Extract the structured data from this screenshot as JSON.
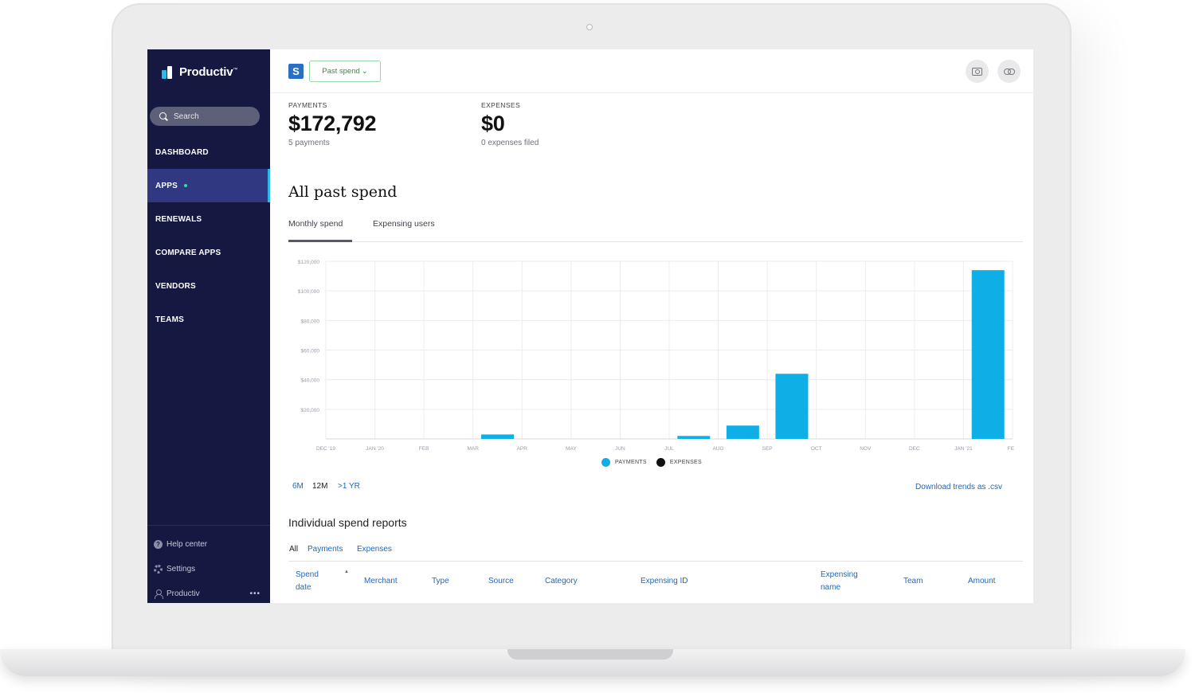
{
  "sidebar": {
    "brand": "Productiv",
    "search_label": "Search",
    "nav": [
      {
        "label": "DASHBOARD",
        "active": false
      },
      {
        "label": "APPS",
        "active": true
      },
      {
        "label": "RENEWALS",
        "active": false
      },
      {
        "label": "COMPARE APPS",
        "active": false
      },
      {
        "label": "VENDORS",
        "active": false
      },
      {
        "label": "TEAMS",
        "active": false
      }
    ],
    "footer": {
      "help": "Help center",
      "settings": "Settings",
      "account": "Productiv",
      "more": "•••"
    }
  },
  "header": {
    "app_icon_letter": "S",
    "period_selector": "Past spend",
    "actions": [
      "camera-icon",
      "link-icon"
    ]
  },
  "stats": {
    "payments": {
      "label": "PAYMENTS",
      "value": "$172,792",
      "sub": "5 payments"
    },
    "expenses": {
      "label": "EXPENSES",
      "value": "$0",
      "sub": "0 expenses filed"
    }
  },
  "section": {
    "title": "All past spend",
    "tabs": [
      {
        "label": "Monthly spend",
        "active": true
      },
      {
        "label": "Expensing users",
        "active": false
      }
    ]
  },
  "chart_data": {
    "type": "bar",
    "categories": [
      "DEC '19",
      "JAN '20",
      "FEB",
      "MAR",
      "APR",
      "MAY",
      "JUN",
      "JUL",
      "AUG",
      "SEP",
      "OCT",
      "NOV",
      "DEC",
      "JAN '21",
      "FEB"
    ],
    "series": [
      {
        "name": "PAYMENTS",
        "color": "#0eaee6",
        "values": [
          0,
          0,
          0,
          3000,
          0,
          0,
          0,
          2000,
          9000,
          44000,
          0,
          0,
          0,
          114000,
          0
        ]
      },
      {
        "name": "EXPENSES",
        "color": "#111111",
        "values": [
          0,
          0,
          0,
          0,
          0,
          0,
          0,
          0,
          0,
          0,
          0,
          0,
          0,
          0,
          0
        ]
      }
    ],
    "yticks": [
      "$120,000",
      "$100,000",
      "$80,000",
      "$60,000",
      "$40,000",
      "$20,000"
    ],
    "ylim": [
      0,
      120000
    ],
    "grid": true,
    "legend": "bottom-center"
  },
  "range_options": [
    {
      "label": "6M",
      "selected": false
    },
    {
      "label": "12M",
      "selected": true
    },
    {
      "label": ">1 YR",
      "selected": false
    }
  ],
  "download_label": "Download trends as .csv",
  "reports": {
    "title": "Individual spend reports",
    "filters": [
      {
        "label": "All",
        "selected": true
      },
      {
        "label": "Payments",
        "selected": false
      },
      {
        "label": "Expenses",
        "selected": false
      }
    ],
    "columns": [
      "Spend date",
      "Merchant",
      "Type",
      "Source",
      "Category",
      "Expensing ID",
      "Expensing name",
      "Team",
      "Amount"
    ]
  }
}
